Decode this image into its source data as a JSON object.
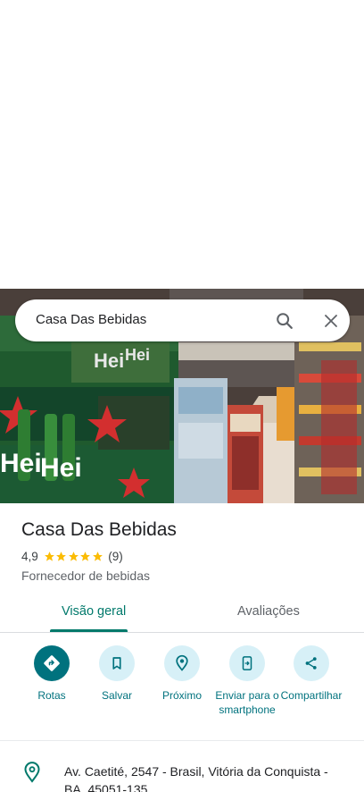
{
  "search": {
    "query": "Casa Das Bebidas"
  },
  "place": {
    "name": "Casa Das Bebidas",
    "rating": "4,9",
    "stars": 5,
    "review_count": "(9)",
    "category": "Fornecedor de bebidas"
  },
  "tabs": [
    {
      "label": "Visão geral",
      "active": true
    },
    {
      "label": "Avaliações",
      "active": false
    }
  ],
  "actions": [
    {
      "label": "Rotas",
      "icon": "directions-icon"
    },
    {
      "label": "Salvar",
      "icon": "bookmark-icon"
    },
    {
      "label": "Próximo",
      "icon": "nearby-icon"
    },
    {
      "label": "Enviar para o smartphone",
      "icon": "send-to-phone-icon"
    },
    {
      "label": "Compartilhar",
      "icon": "share-icon"
    }
  ],
  "address": {
    "text": "Av. Caetité, 2547 - Brasil, Vitória da Conquista - BA, 45051-135"
  },
  "photo": {
    "printed_text": [
      "Hei",
      "Hei",
      "Hei",
      "Hei"
    ]
  },
  "colors": {
    "accent": "#00727e",
    "tab_accent": "#00796b",
    "action_bg": "#d7f0f7",
    "star": "#fbbc04",
    "pin": "#00796b"
  }
}
